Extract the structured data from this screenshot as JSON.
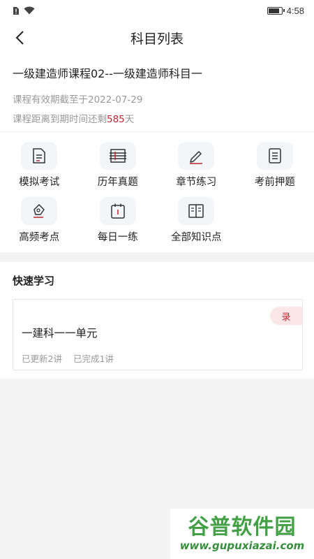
{
  "status": {
    "time": "4:58"
  },
  "nav": {
    "title": "科目列表"
  },
  "course": {
    "title": "一级建造师课程02--一级建造师科目一",
    "valid_prefix": "课程有效期截至于",
    "valid_date": "2022-07-29",
    "remain_prefix": "课程距离到期时间还剩",
    "remain_days": "585",
    "remain_suffix": "天"
  },
  "grid": [
    {
      "label": "模拟考试",
      "icon": "exam-paper-icon"
    },
    {
      "label": "历年真题",
      "icon": "question-bank-icon"
    },
    {
      "label": "章节练习",
      "icon": "pencil-icon"
    },
    {
      "label": "考前押题",
      "icon": "document-list-icon"
    },
    {
      "label": "高频考点",
      "icon": "pen-nib-icon"
    },
    {
      "label": "每日一练",
      "icon": "calendar-icon"
    },
    {
      "label": "全部知识点",
      "icon": "book-icon"
    }
  ],
  "quick": {
    "title": "快速学习",
    "card": {
      "tag": "录",
      "title": "一建科一一单元",
      "updated": "已更新2讲",
      "completed": "已完成1讲"
    }
  },
  "watermark": {
    "top": "谷普软件园",
    "bottom": "www.gupuxiazai.com"
  },
  "colors": {
    "accent": "#b7282e",
    "tag_bg": "#fbe7e8",
    "icon_bg": "#f4f5f8"
  }
}
